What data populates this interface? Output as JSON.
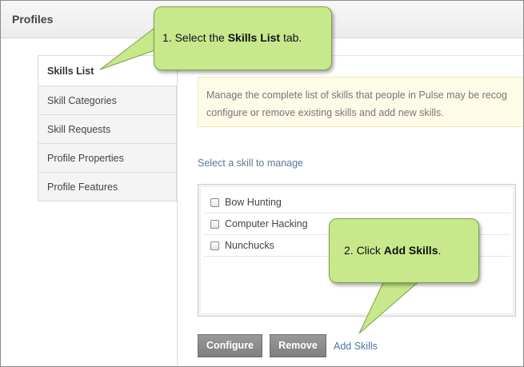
{
  "header": {
    "title": "Profiles"
  },
  "tabs": [
    {
      "label": "Skills List",
      "active": true
    },
    {
      "label": "Skill Categories",
      "active": false
    },
    {
      "label": "Skill Requests",
      "active": false
    },
    {
      "label": "Profile Properties",
      "active": false
    },
    {
      "label": "Profile Features",
      "active": false
    }
  ],
  "info": {
    "line1": "Manage the complete list of skills that people in Pulse may be recog",
    "line2": "configure or remove existing skills and add new skills."
  },
  "select_label": "Select a skill to manage",
  "skills": [
    {
      "label": "Bow Hunting",
      "checked": false
    },
    {
      "label": "Computer Hacking",
      "checked": false
    },
    {
      "label": "Nunchucks",
      "checked": false
    }
  ],
  "buttons": {
    "configure": "Configure",
    "remove": "Remove",
    "add_skills": "Add Skills"
  },
  "callouts": {
    "step1": {
      "prefix": "1. Select the ",
      "bold": "Skills List",
      "suffix": " tab."
    },
    "step2": {
      "prefix": "2. Click ",
      "bold": "Add Skills",
      "suffix": "."
    }
  },
  "colors": {
    "callout_fill": "#c8e88c",
    "button_gray": "#8a8a8a",
    "link_blue": "#4f77a8",
    "info_bg": "#fefbe6"
  }
}
